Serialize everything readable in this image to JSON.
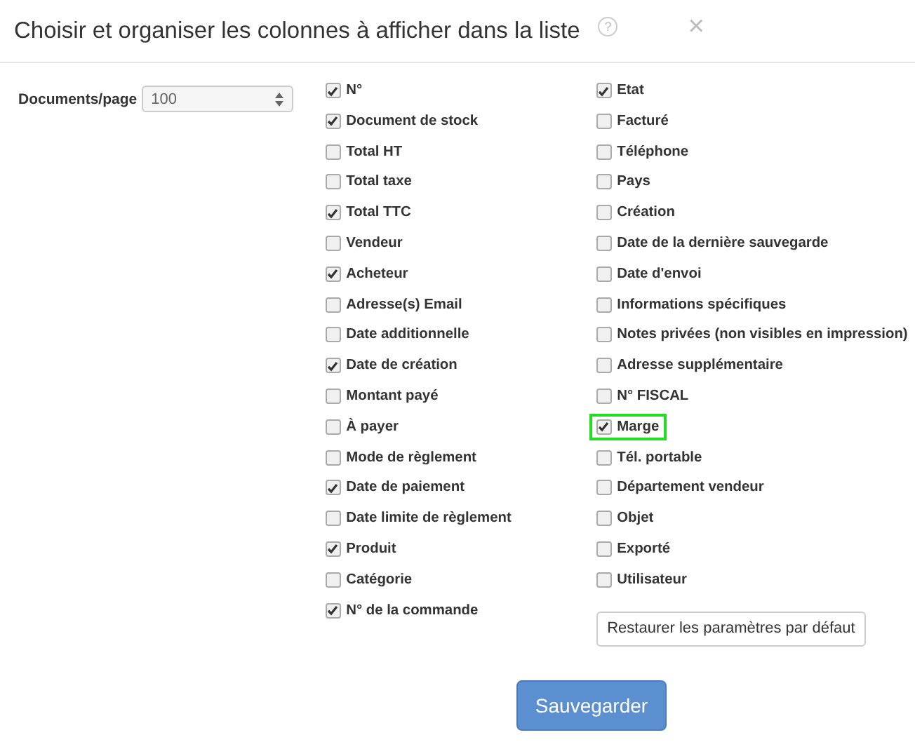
{
  "dialog": {
    "title": "Choisir et organiser les colonnes à afficher dans la liste",
    "help": "?",
    "close": "×"
  },
  "page_size": {
    "label": "Documents/page",
    "value": "100"
  },
  "columns": [
    [
      {
        "label": "N°",
        "checked": true,
        "highlighted": false
      },
      {
        "label": "Document de stock",
        "checked": true,
        "highlighted": false
      },
      {
        "label": "Total HT",
        "checked": false,
        "highlighted": false
      },
      {
        "label": "Total taxe",
        "checked": false,
        "highlighted": false
      },
      {
        "label": "Total TTC",
        "checked": true,
        "highlighted": false
      },
      {
        "label": "Vendeur",
        "checked": false,
        "highlighted": false
      },
      {
        "label": "Acheteur",
        "checked": true,
        "highlighted": false
      },
      {
        "label": "Adresse(s) Email",
        "checked": false,
        "highlighted": false
      },
      {
        "label": "Date additionnelle",
        "checked": false,
        "highlighted": false
      },
      {
        "label": "Date de création",
        "checked": true,
        "highlighted": false
      },
      {
        "label": "Montant payé",
        "checked": false,
        "highlighted": false
      },
      {
        "label": "À payer",
        "checked": false,
        "highlighted": false
      },
      {
        "label": "Mode de règlement",
        "checked": false,
        "highlighted": false
      },
      {
        "label": "Date de paiement",
        "checked": true,
        "highlighted": false
      },
      {
        "label": "Date limite de règlement",
        "checked": false,
        "highlighted": false
      },
      {
        "label": "Produit",
        "checked": true,
        "highlighted": false
      },
      {
        "label": "Catégorie",
        "checked": false,
        "highlighted": false
      },
      {
        "label": "N° de la commande",
        "checked": true,
        "highlighted": false
      }
    ],
    [
      {
        "label": "Etat",
        "checked": true,
        "highlighted": false
      },
      {
        "label": "Facturé",
        "checked": false,
        "highlighted": false
      },
      {
        "label": "Téléphone",
        "checked": false,
        "highlighted": false
      },
      {
        "label": "Pays",
        "checked": false,
        "highlighted": false
      },
      {
        "label": "Création",
        "checked": false,
        "highlighted": false
      },
      {
        "label": "Date de la dernière sauvegarde",
        "checked": false,
        "highlighted": false
      },
      {
        "label": "Date d'envoi",
        "checked": false,
        "highlighted": false
      },
      {
        "label": "Informations spécifiques",
        "checked": false,
        "highlighted": false
      },
      {
        "label": "Notes privées (non visibles en impression)",
        "checked": false,
        "highlighted": false
      },
      {
        "label": "Adresse supplémentaire",
        "checked": false,
        "highlighted": false
      },
      {
        "label": "N° FISCAL",
        "checked": false,
        "highlighted": false
      },
      {
        "label": "Marge",
        "checked": true,
        "highlighted": true
      },
      {
        "label": "Tél. portable",
        "checked": false,
        "highlighted": false
      },
      {
        "label": "Département vendeur",
        "checked": false,
        "highlighted": false
      },
      {
        "label": "Objet",
        "checked": false,
        "highlighted": false
      },
      {
        "label": "Exporté",
        "checked": false,
        "highlighted": false
      },
      {
        "label": "Utilisateur",
        "checked": false,
        "highlighted": false
      }
    ]
  ],
  "reset_button": "Restaurer les paramètres par défaut",
  "save_button": "Sauvegarder"
}
